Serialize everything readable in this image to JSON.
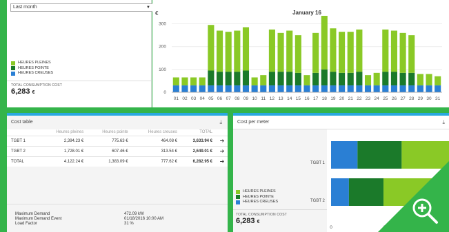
{
  "filter": {
    "selected": "Last month"
  },
  "legend": [
    {
      "label": "HEURES PLEINES",
      "color": "#8ac926"
    },
    {
      "label": "HEURES POINTE",
      "color": "#1b7a2a"
    },
    {
      "label": "HEURES CREUSES",
      "color": "#2a7fd4"
    }
  ],
  "total_cost": {
    "label": "TOTAL CONSUMPTION COST",
    "value": "6,283",
    "unit": "€"
  },
  "chart_data": {
    "type": "bar",
    "title": "January 16",
    "ylabel": "€",
    "ylim": [
      0,
      350
    ],
    "yticks": [
      0,
      100,
      200,
      300
    ],
    "categories": [
      "01",
      "02",
      "03",
      "04",
      "05",
      "06",
      "07",
      "08",
      "09",
      "10",
      "11",
      "12",
      "13",
      "14",
      "15",
      "16",
      "17",
      "18",
      "19",
      "20",
      "21",
      "22",
      "23",
      "24",
      "25",
      "26",
      "27",
      "28",
      "29",
      "30",
      "31"
    ],
    "series": [
      {
        "name": "HEURES CREUSES",
        "color": "#2a7fd4",
        "values": [
          30,
          30,
          30,
          30,
          30,
          30,
          30,
          30,
          30,
          30,
          30,
          30,
          30,
          30,
          30,
          30,
          30,
          30,
          30,
          30,
          30,
          30,
          30,
          30,
          30,
          30,
          30,
          30,
          30,
          30,
          30
        ]
      },
      {
        "name": "HEURES POINTE",
        "color": "#1b7a2a",
        "values": [
          0,
          0,
          0,
          0,
          65,
          60,
          60,
          60,
          65,
          0,
          0,
          60,
          60,
          60,
          55,
          0,
          55,
          70,
          60,
          55,
          55,
          60,
          0,
          0,
          60,
          60,
          55,
          55,
          0,
          0,
          0
        ]
      },
      {
        "name": "HEURES PLEINES",
        "color": "#8ac926",
        "values": [
          35,
          35,
          35,
          35,
          200,
          180,
          175,
          180,
          190,
          35,
          45,
          185,
          170,
          180,
          165,
          45,
          175,
          235,
          190,
          180,
          180,
          185,
          45,
          55,
          185,
          180,
          175,
          165,
          50,
          50,
          40
        ]
      }
    ]
  },
  "cost_table": {
    "title": "Cost table",
    "columns": [
      "",
      "Heures pleines",
      "Heures pointe",
      "Heures creuses",
      "TOTAL"
    ],
    "rows": [
      [
        "TGBT 1",
        "2,394.23 €",
        "775.63 €",
        "464.08 €",
        "3,633.94 €"
      ],
      [
        "TGBT 2",
        "1,728.01 €",
        "607.46 €",
        "313.54 €",
        "2,649.01 €"
      ],
      [
        "TOTAL",
        "4,122.24 €",
        "1,383.09 €",
        "777.62 €",
        "6,282.95 €"
      ]
    ],
    "arrow": "➔"
  },
  "summary": [
    {
      "label": "Maximum Demand",
      "value": "472.09 kW"
    },
    {
      "label": "Maximum Demand Event",
      "value": "01/18/2016 10:00 AM"
    },
    {
      "label": "Load Factor",
      "value": "31 %"
    }
  ],
  "cost_per_meter": {
    "title": "Cost per meter",
    "meters": [
      "TGBT 1",
      "TGBT 2"
    ],
    "xticks": [
      "0",
      "1000",
      "2000"
    ],
    "chart_data": {
      "type": "bar",
      "orientation": "horizontal",
      "categories": [
        "TGBT 1",
        "TGBT 2"
      ],
      "xlim": [
        0,
        4000
      ],
      "series": [
        {
          "name": "HEURES CREUSES",
          "color": "#2a7fd4",
          "values": [
            464.08,
            313.54
          ]
        },
        {
          "name": "HEURES POINTE",
          "color": "#1b7a2a",
          "values": [
            775.63,
            607.46
          ]
        },
        {
          "name": "HEURES PLEINES",
          "color": "#8ac926",
          "values": [
            2394.23,
            1728.01
          ]
        }
      ]
    }
  },
  "download_icon": "download-icon",
  "zoom_icon": "zoom-in-icon"
}
